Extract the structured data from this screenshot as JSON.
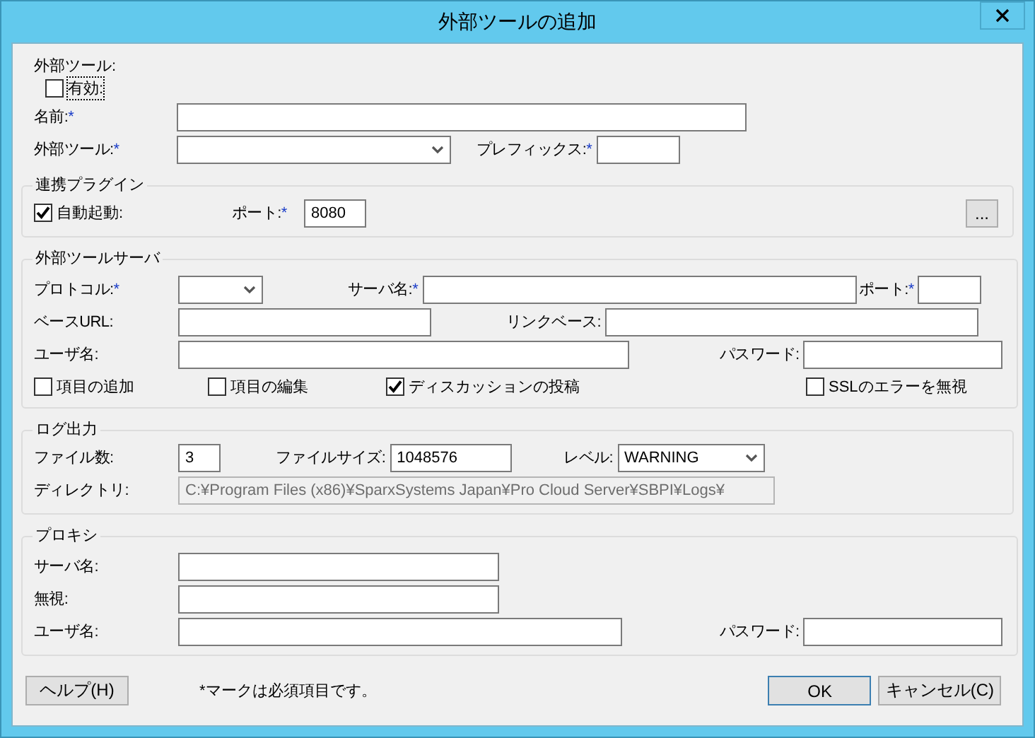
{
  "window": {
    "title": "外部ツールの追加"
  },
  "tool": {
    "heading": "外部ツール:",
    "enabled": {
      "label": "有効:",
      "checked": false
    },
    "name": {
      "label": "名前:",
      "mark": "*"
    },
    "tool": {
      "label": "外部ツール:",
      "mark": "*"
    },
    "prefix": {
      "label": "プレフィックス:",
      "mark": "*"
    }
  },
  "plugin": {
    "title": "連携プラグイン",
    "autostart": {
      "label": "自動起動:",
      "checked": true
    },
    "port": {
      "label": "ポート:",
      "mark": "*",
      "value": "8080"
    },
    "browse": "..."
  },
  "server": {
    "title": "外部ツールサーバ",
    "protocol": {
      "label": "プロトコル:",
      "mark": "*"
    },
    "server_name": {
      "label": "サーバ名:",
      "mark": "*"
    },
    "port": {
      "label": "ポート:",
      "mark": "*"
    },
    "base_url": {
      "label": "ベースURL:"
    },
    "link_base": {
      "label": "リンクベース:"
    },
    "user": {
      "label": "ユーザ名:"
    },
    "password": {
      "label": "パスワード:"
    },
    "options": [
      {
        "label": "項目の追加",
        "checked": false
      },
      {
        "label": "項目の編集",
        "checked": false
      },
      {
        "label": "ディスカッションの投稿",
        "checked": true
      },
      {
        "label": "SSLのエラーを無視",
        "checked": false
      }
    ]
  },
  "log": {
    "title": "ログ出力",
    "file_count": {
      "label": "ファイル数:",
      "value": "3"
    },
    "file_size": {
      "label": "ファイルサイズ:",
      "value": "1048576"
    },
    "level": {
      "label": "レベル:",
      "value": "WARNING"
    },
    "directory": {
      "label": "ディレクトリ:",
      "value": "C:¥Program Files (x86)¥SparxSystems Japan¥Pro Cloud Server¥SBPI¥Logs¥",
      "disabled": true
    }
  },
  "proxy": {
    "title": "プロキシ",
    "server_name": {
      "label": "サーバ名:"
    },
    "ignore": {
      "label": "無視:"
    },
    "user": {
      "label": "ユーザ名:"
    },
    "password": {
      "label": "パスワード:"
    }
  },
  "footer": {
    "help": "ヘルプ(H)",
    "note": "*マークは必須項目です。",
    "ok": "OK",
    "cancel": "キャンセル(C)"
  }
}
